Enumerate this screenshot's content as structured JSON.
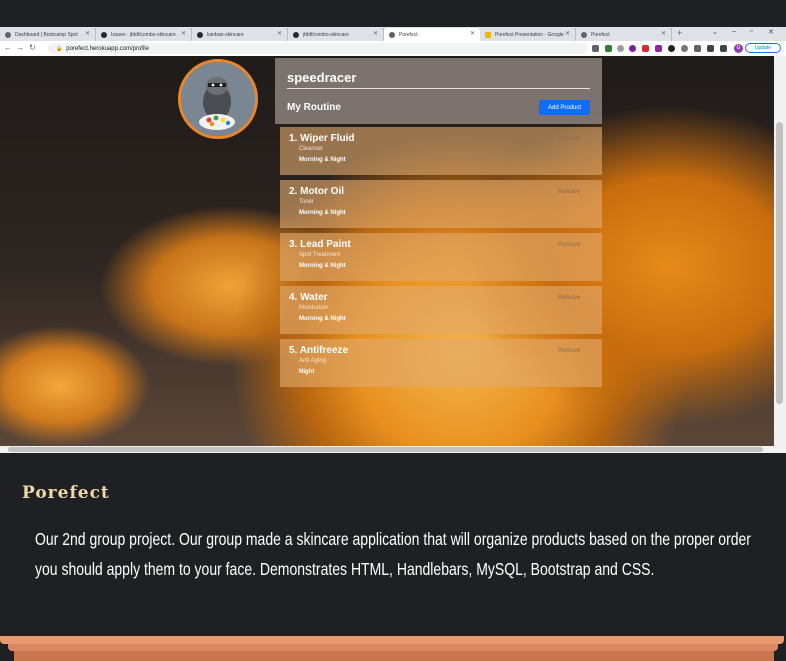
{
  "browser": {
    "tabs": [
      {
        "label": "Dashboard | Bootcamp Spot",
        "favicon_color": "#5f6368"
      },
      {
        "label": "Issues · jtttdl/combo-skincare",
        "favicon_color": "#24292f"
      },
      {
        "label": "kanban-skincare",
        "favicon_color": "#24292f"
      },
      {
        "label": "jtttdl/combo-skincare",
        "favicon_color": "#24292f"
      },
      {
        "label": "Porefect",
        "favicon_color": "#5f6368"
      },
      {
        "label": "Porefect Presentation - Google",
        "favicon_color": "#f4b400"
      },
      {
        "label": "Porefect",
        "favicon_color": "#5f6368"
      }
    ],
    "active_tab": 4,
    "url": "porefect.herokuapp.com/profile",
    "update_label": "Update",
    "profile_initial": "G"
  },
  "profile": {
    "username": "speedracer",
    "routine_title": "My Routine",
    "add_product_label": "Add Product"
  },
  "products": [
    {
      "name": "1. Wiper Fluid",
      "type": "Cleanser",
      "time": "Morning & Night",
      "remove": "Remove"
    },
    {
      "name": "2. Motor Oil",
      "type": "Toner",
      "time": "Morning & Night",
      "remove": "Remove"
    },
    {
      "name": "3. Lead Paint",
      "type": "Spot Treatment",
      "time": "Morning & Night",
      "remove": "Remove"
    },
    {
      "name": "4. Water",
      "type": "Moisturizer",
      "time": "Morning & Night",
      "remove": "Remove"
    },
    {
      "name": "5. Antifreeze",
      "type": "Anti Aging",
      "time": "Night",
      "remove": "Remove"
    }
  ],
  "project": {
    "title": "Porefect",
    "description": "Our 2nd group project. Our group made a skincare application that will organize products based on the proper order you should apply them to your face. Demonstrates HTML, Handlebars, MySQL, Bootstrap and CSS."
  },
  "colors": {
    "accent": "#0d6efd",
    "avatar_border": "#e8872b",
    "title": "#f1d9a6"
  }
}
